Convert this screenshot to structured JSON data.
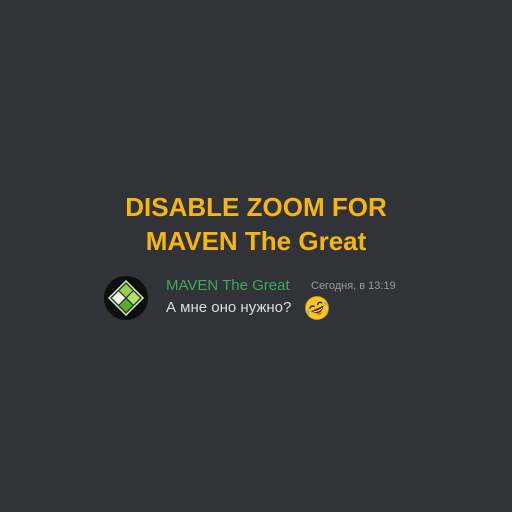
{
  "headline": {
    "line1": "DISABLE ZOOM FOR",
    "line2": "MAVEN The Great"
  },
  "message": {
    "author": "MAVEN The Great",
    "timestamp": "Сегодня, в 13:19",
    "text": "А мне оно нужно?",
    "emoji": "rolling-on-floor-laughing"
  },
  "colors": {
    "background": "#313338",
    "headline": "#f6b611",
    "author": "#3fa85a",
    "timestamp": "#949ba4",
    "text": "#dbdee1"
  }
}
